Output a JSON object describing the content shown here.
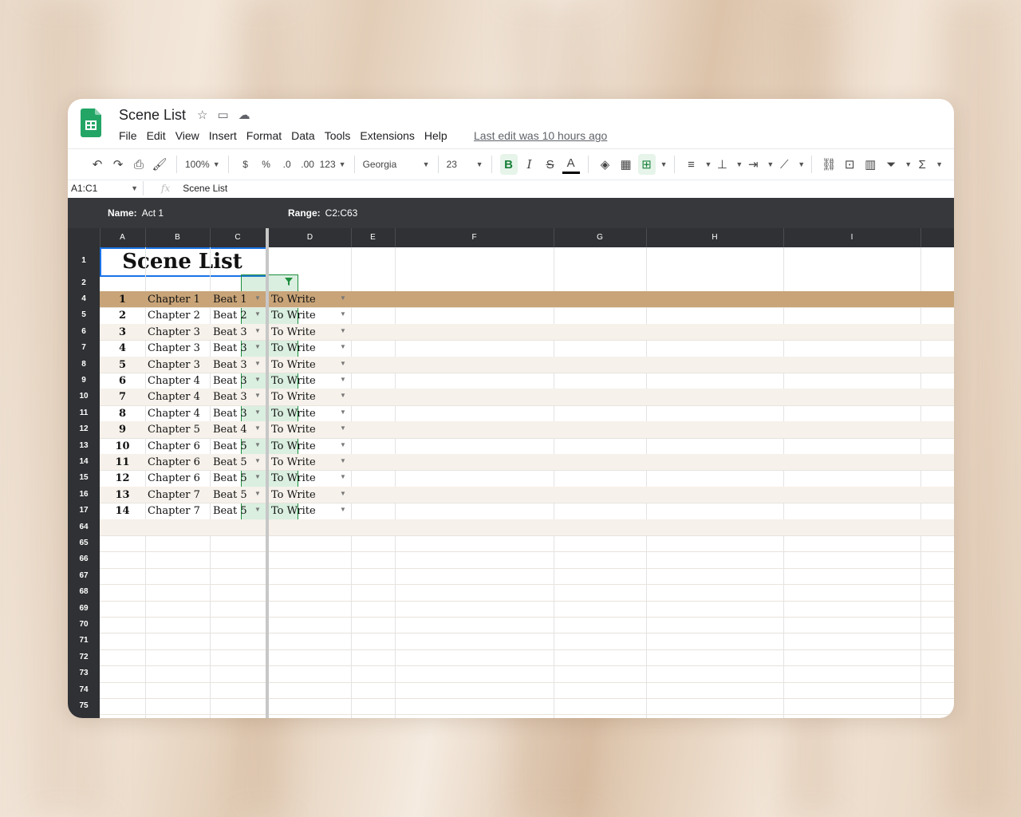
{
  "app": {
    "title": "Scene List",
    "menu": [
      "File",
      "Edit",
      "View",
      "Insert",
      "Format",
      "Data",
      "Tools",
      "Extensions",
      "Help"
    ],
    "last_edit": "Last edit was 10 hours ago"
  },
  "toolbar": {
    "zoom": "100%",
    "currency": "$",
    "percent": "%",
    "dec_decrease": ".0",
    "dec_increase": ".00",
    "number_format": "123",
    "font": "Georgia",
    "font_size": "23",
    "bold": "B",
    "italic": "I",
    "strike": "S",
    "text_color": "A"
  },
  "formula_bar": {
    "name_box": "A1:C1",
    "fx": "fx",
    "value": "Scene List"
  },
  "named_range": {
    "name_label": "Name:",
    "name_value": "Act 1",
    "range_label": "Range:",
    "range_value": "C2:C63"
  },
  "columns": [
    "A",
    "B",
    "C",
    "D",
    "E",
    "F",
    "G",
    "H",
    "I"
  ],
  "row_numbers": [
    "1",
    "2",
    "4",
    "5",
    "6",
    "7",
    "8",
    "9",
    "10",
    "11",
    "12",
    "13",
    "14",
    "15",
    "16",
    "17",
    "64",
    "65",
    "66",
    "67",
    "68",
    "69",
    "70",
    "71",
    "72",
    "73",
    "74",
    "75"
  ],
  "sheet_title": "Scene List",
  "rows": [
    {
      "n": "1",
      "chapter": "Chapter 1",
      "beat": "Beat 1",
      "status": "To Write"
    },
    {
      "n": "2",
      "chapter": "Chapter 2",
      "beat": "Beat 2",
      "status": "To Write"
    },
    {
      "n": "3",
      "chapter": "Chapter 3",
      "beat": "Beat 3",
      "status": "To Write"
    },
    {
      "n": "4",
      "chapter": "Chapter 3",
      "beat": "Beat 3",
      "status": "To Write"
    },
    {
      "n": "5",
      "chapter": "Chapter 3",
      "beat": "Beat 3",
      "status": "To Write"
    },
    {
      "n": "6",
      "chapter": "Chapter 4",
      "beat": "Beat 3",
      "status": "To Write"
    },
    {
      "n": "7",
      "chapter": "Chapter 4",
      "beat": "Beat 3",
      "status": "To Write"
    },
    {
      "n": "8",
      "chapter": "Chapter 4",
      "beat": "Beat 3",
      "status": "To Write"
    },
    {
      "n": "9",
      "chapter": "Chapter 5",
      "beat": "Beat 4",
      "status": "To Write"
    },
    {
      "n": "10",
      "chapter": "Chapter 6",
      "beat": "Beat 5",
      "status": "To Write"
    },
    {
      "n": "11",
      "chapter": "Chapter 6",
      "beat": "Beat 5",
      "status": "To Write"
    },
    {
      "n": "12",
      "chapter": "Chapter 6",
      "beat": "Beat 5",
      "status": "To Write"
    },
    {
      "n": "13",
      "chapter": "Chapter 7",
      "beat": "Beat 5",
      "status": "To Write"
    },
    {
      "n": "14",
      "chapter": "Chapter 7",
      "beat": "Beat 5",
      "status": "To Write"
    }
  ],
  "colors": {
    "highlight_row": "#c8a478",
    "alt_row": "#f6f1ea",
    "selection_green": "#1e8e3e",
    "header_dark": "#2f3134"
  }
}
